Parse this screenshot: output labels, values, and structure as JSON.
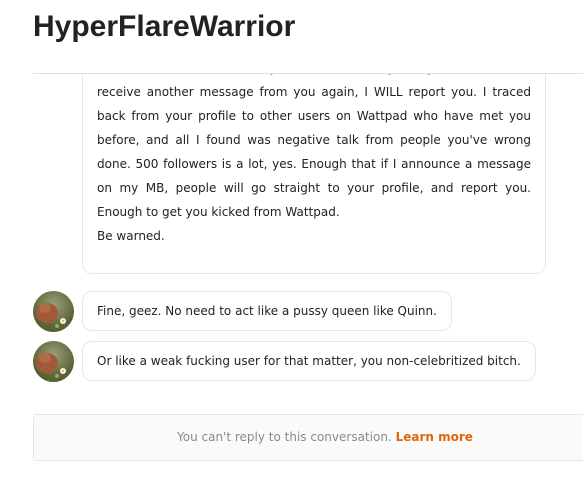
{
  "header": {
    "title": "HyperFlareWarrior"
  },
  "messages": [
    {
      "paragraphs": [
        "onto the back foot. If I hear you've bothered any of my friends, and if I receive another message from you again, I WILL report you. I traced back from your profile to other users on Wattpad who have met you before, and all I found was negative talk from people you've wrong done. 500 followers is a lot, yes. Enough that if I announce a message on my MB, people will go straight to your profile, and report you. Enough to get you kicked from Wattpad.",
        "Be warned."
      ]
    },
    {
      "text": "Fine, geez. No need to act like a pussy queen like Quinn."
    },
    {
      "text": "Or like a weak fucking user for that matter, you non-celebritized bitch."
    }
  ],
  "footer": {
    "notice": "You can't reply to this conversation.",
    "link": "Learn more"
  },
  "colors": {
    "link": "#e0660e",
    "muted_text": "#8a8a8a",
    "border": "#e6e6e6"
  }
}
